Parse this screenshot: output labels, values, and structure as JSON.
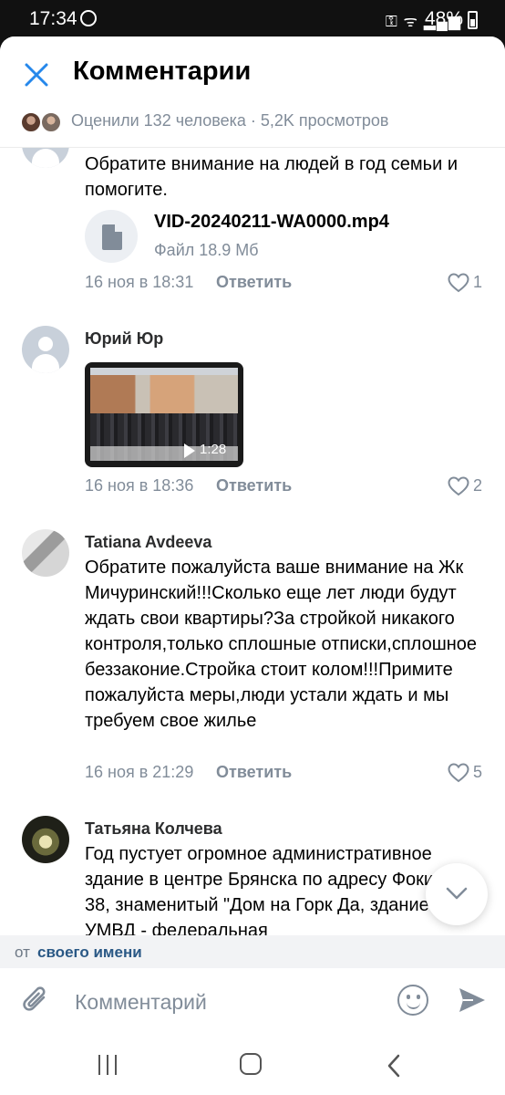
{
  "status_bar": {
    "time": "17:34",
    "battery": "48%",
    "icons": [
      "whatsapp-icon",
      "key-icon",
      "wifi-call-icon",
      "signal-icon",
      "volte-icon",
      "signal-icon",
      "battery-icon"
    ]
  },
  "header": {
    "title": "Комментарии",
    "likes_summary": "Оценили 132 человека · 5,2K просмотров"
  },
  "comments": [
    {
      "author": "",
      "text": "Обратите внимание на людей в год семьи и помогите.",
      "attachment": {
        "type": "file",
        "name": "VID-20240211-WA0000.mp4",
        "size": "Файл 18.9 Мб"
      },
      "date": "16 ноя в 18:31",
      "reply_label": "Ответить",
      "likes": "1"
    },
    {
      "author": "Юрий Юр",
      "text": "",
      "attachment": {
        "type": "video",
        "duration": "1:28"
      },
      "date": "16 ноя в 18:36",
      "reply_label": "Ответить",
      "likes": "2"
    },
    {
      "author": "Tatiana Avdeeva",
      "text": "Обратите пожалуйста ваше внимание на Жк Мичуринский!!!Сколько еще лет люди будут ждать свои квартиры?За стройкой никакого контроля,только сплошные отписки,сплошное беззаконие.Стройка стоит колом!!!Примите пожалуйста меры,люди устали ждать и мы требуем свое жилье",
      "date": "16 ноя в 21:29",
      "reply_label": "Ответить",
      "likes": "5"
    },
    {
      "author": "Татьяна Колчева",
      "text": "Год пустует огромное административное здание в центре Брянска по адресу Фокина 38, знаменитый \"Дом на Горк Да, здание УМВД - федеральная"
    }
  ],
  "from_line": {
    "prefix": "от",
    "name": "своего имени"
  },
  "composer": {
    "placeholder": "Комментарий"
  },
  "colors": {
    "accent": "#2688eb",
    "secondary_text": "#818c99",
    "link": "#2a5885"
  }
}
